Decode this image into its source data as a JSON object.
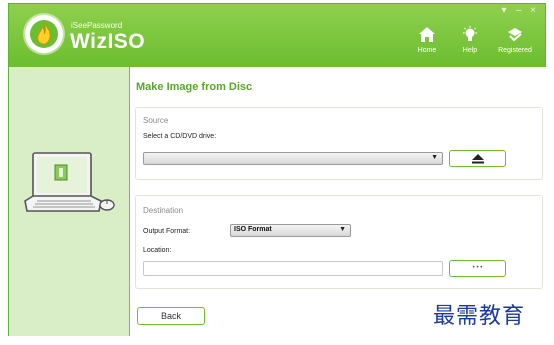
{
  "app": {
    "brand_small": "iSeePassword",
    "brand_name": "WizISO",
    "accent_color": "#6cbd2f",
    "window_controls": [
      "▾",
      "–",
      "×"
    ]
  },
  "nav": {
    "home_label": "Home",
    "help_label": "Help",
    "registered_label": "Registered"
  },
  "icons": {
    "logo": "flame-icon",
    "home": "home-icon",
    "help": "lightbulb-icon",
    "registered": "user-check-icon",
    "eject": "eject-icon",
    "illustration": "laptop-with-mouse-icon"
  },
  "page": {
    "title": "Make Image from Disc"
  },
  "source": {
    "title": "Source",
    "drive_label": "Select a CD/DVD drive:",
    "drive_value": ""
  },
  "destination": {
    "title": "Destination",
    "format_label": "Output Format:",
    "format_value": "ISO Format",
    "location_label": "Location:",
    "location_value": "",
    "browse_label": "• • •"
  },
  "footer": {
    "back_label": "Back"
  },
  "watermark": "最需教育"
}
